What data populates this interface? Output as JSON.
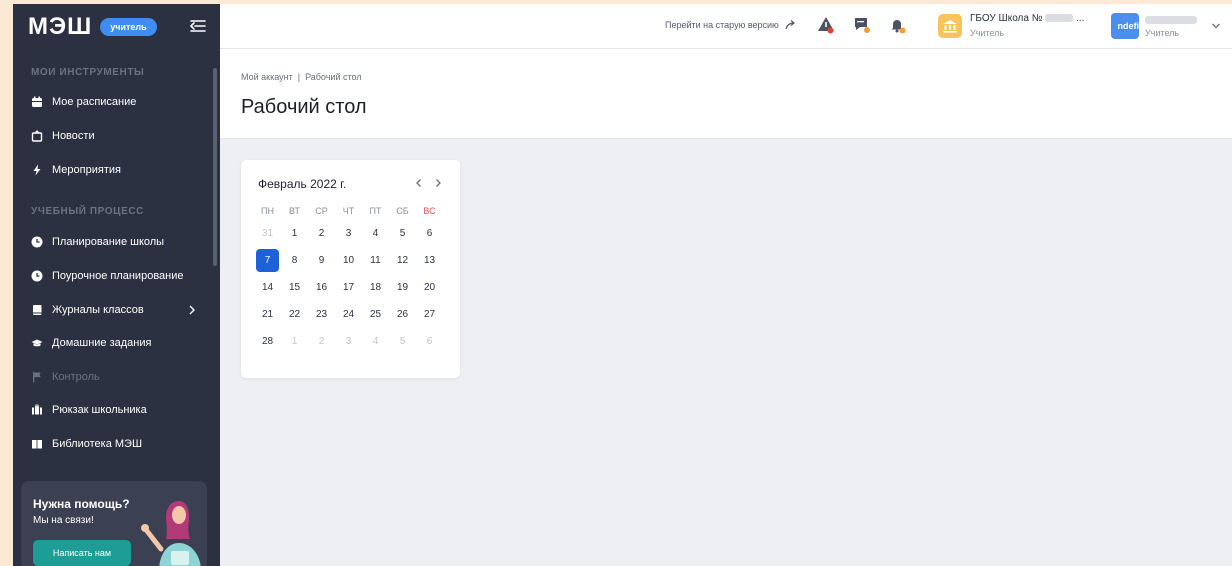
{
  "sidebar": {
    "logo": "МЭШ",
    "role_badge": "учитель",
    "sections": [
      {
        "title": "Мои инструменты"
      },
      {
        "title": "Учебный процесс"
      }
    ],
    "items": [
      {
        "label": "Мое расписание",
        "icon": "calendar-icon"
      },
      {
        "label": "Новости",
        "icon": "news-icon"
      },
      {
        "label": "Мероприятия",
        "icon": "lightning-icon"
      },
      {
        "label": "Планирование школы",
        "icon": "clock-icon"
      },
      {
        "label": "Поурочное планирование",
        "icon": "clock-icon"
      },
      {
        "label": "Журналы классов",
        "icon": "book-icon"
      },
      {
        "label": "Домашние задания",
        "icon": "graduation-cap-icon"
      },
      {
        "label": "Контроль",
        "icon": "flag-icon",
        "disabled": true
      },
      {
        "label": "Рюкзак школьника",
        "icon": "backpack-icon"
      },
      {
        "label": "Библиотека МЭШ",
        "icon": "library-icon"
      }
    ],
    "help": {
      "title": "Нужна помощь?",
      "subtitle": "Мы на связи!",
      "button": "Написать нам"
    }
  },
  "header": {
    "old_version_link": "Перейти на старую версию",
    "school": {
      "name": "ГБОУ Школа №",
      "role": "Учитель"
    },
    "user": {
      "avatar_text": "ndefi",
      "role": "Учитель"
    }
  },
  "breadcrumb": {
    "home": "Мой аккаунт",
    "separator": "|",
    "current": "Рабочий стол"
  },
  "page_title": "Рабочий стол",
  "calendar": {
    "month_label": "Февраль 2022 г.",
    "weekdays": [
      "ПН",
      "ВТ",
      "СР",
      "ЧТ",
      "ПТ",
      "СБ",
      "ВС"
    ],
    "weeks": [
      [
        "31",
        "1",
        "2",
        "3",
        "4",
        "5",
        "6"
      ],
      [
        "7",
        "8",
        "9",
        "10",
        "11",
        "12",
        "13"
      ],
      [
        "14",
        "15",
        "16",
        "17",
        "18",
        "19",
        "20"
      ],
      [
        "21",
        "22",
        "23",
        "24",
        "25",
        "26",
        "27"
      ],
      [
        "28",
        "1",
        "2",
        "3",
        "4",
        "5",
        "6"
      ]
    ],
    "today": "7"
  },
  "colors": {
    "sidebar_bg": "#2b3140",
    "accent": "#1c61d6",
    "help_button": "#1d9d96",
    "sunday": "#e05353"
  }
}
